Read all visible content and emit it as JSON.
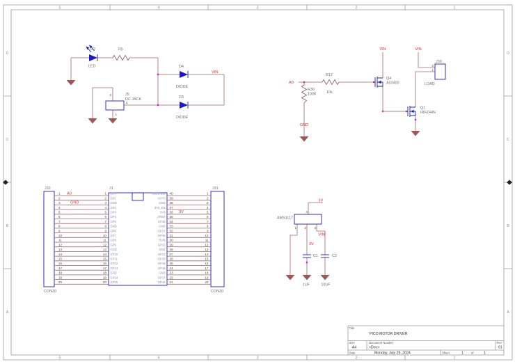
{
  "zones": {
    "top": [
      "5",
      "4",
      "3",
      "2",
      "1"
    ],
    "bottom": [
      "5",
      "4",
      "3",
      "2",
      "1"
    ],
    "left": [
      "D",
      "C",
      "B",
      "A"
    ],
    "right": [
      "D",
      "C",
      "B",
      "A"
    ]
  },
  "title_block": {
    "title_label": "Title",
    "title": "PICO MOTOR DRIVER",
    "size_label": "Size",
    "size": "A4",
    "doc_label": "Document Number",
    "doc": "<Doc>",
    "rev_label": "Rev",
    "rev": "01",
    "date_label": "Date",
    "date": "Monday, July 29, 2024",
    "sheet_label": "Sheet",
    "sheet_num": "1",
    "of_label": "of",
    "sheet_total": "1"
  },
  "power_input": {
    "led_ref": "D2",
    "led_val": "LED",
    "r5_ref": "R5",
    "d4_ref": "D4",
    "d4_val": "DIODE",
    "d3_ref": "D3",
    "d3_val": "DIODE",
    "j5_ref": "J5",
    "j5_val": "DC JACK",
    "j5_pin1": "1",
    "j5_pin2": "2",
    "j5_pin3": "3",
    "vin": "VIN"
  },
  "driver": {
    "a0": "A0",
    "gnd": "GND",
    "vin_q4": "VIN",
    "vin_j30": "VIN",
    "r30_ref": "R30",
    "r30_val": "100K",
    "r12_ref": "R12",
    "r12_val": "10k",
    "q4_ref": "Q4",
    "q4_val": "A03400",
    "q1_ref": "Q1",
    "q1_val": "IRFZ44N",
    "j30_ref": "J30",
    "j30_load": "LOAD",
    "j30_pin1": "1",
    "j30_pin2": "2"
  },
  "pico": {
    "j1_ref": "J1",
    "j32_ref": "J32",
    "j32_val": "CON20",
    "j31_ref": "J31",
    "j31_val": "CON20",
    "a0": "A0",
    "gnd": "GND",
    "v3": "3V",
    "left_pins": [
      {
        "num": "1",
        "name": "GP0"
      },
      {
        "num": "2",
        "name": "GP1"
      },
      {
        "num": "3",
        "name": "GND"
      },
      {
        "num": "4",
        "name": "GP2"
      },
      {
        "num": "5",
        "name": "GP3"
      },
      {
        "num": "6",
        "name": "GP4"
      },
      {
        "num": "7",
        "name": "GP5"
      },
      {
        "num": "8",
        "name": "GND"
      },
      {
        "num": "9",
        "name": "GP6"
      },
      {
        "num": "10",
        "name": "GP7"
      },
      {
        "num": "11",
        "name": "GP8"
      },
      {
        "num": "12",
        "name": "GP9"
      },
      {
        "num": "13",
        "name": "GND"
      },
      {
        "num": "14",
        "name": "GP10"
      },
      {
        "num": "15",
        "name": "GP11"
      },
      {
        "num": "16",
        "name": "GP12"
      },
      {
        "num": "17",
        "name": "GP13"
      },
      {
        "num": "18",
        "name": "GND"
      },
      {
        "num": "19",
        "name": "GP14"
      },
      {
        "num": "20",
        "name": "GP15"
      }
    ],
    "right_pins": [
      {
        "num": "40",
        "name": "VBUS-usb"
      },
      {
        "num": "39",
        "name": "VSYS"
      },
      {
        "num": "38",
        "name": "GND"
      },
      {
        "num": "37",
        "name": "3V3_EN"
      },
      {
        "num": "36",
        "name": "3V3"
      },
      {
        "num": "35",
        "name": "VREF"
      },
      {
        "num": "34",
        "name": "GP28"
      },
      {
        "num": "33",
        "name": "GND"
      },
      {
        "num": "32",
        "name": "GP27"
      },
      {
        "num": "31",
        "name": "GP26"
      },
      {
        "num": "30",
        "name": "RUN"
      },
      {
        "num": "29",
        "name": "GP22"
      },
      {
        "num": "28",
        "name": "GND"
      },
      {
        "num": "27",
        "name": "GP21"
      },
      {
        "num": "26",
        "name": "GP20"
      },
      {
        "num": "25",
        "name": "GP19"
      },
      {
        "num": "24",
        "name": "GP18"
      },
      {
        "num": "23",
        "name": "GND"
      },
      {
        "num": "22",
        "name": "GP17"
      },
      {
        "num": "21",
        "name": "GP16"
      }
    ]
  },
  "regulator": {
    "ref": "AMS1117",
    "v3_out": "3V",
    "v3_net": "3V",
    "vin": "VIN",
    "pin1": "1",
    "pin2": "2",
    "pin3": "3",
    "pin4": "4",
    "c1_ref": "C1",
    "c1_val": "1UF",
    "c2_ref": "C2",
    "c2_val": "10UF"
  }
}
